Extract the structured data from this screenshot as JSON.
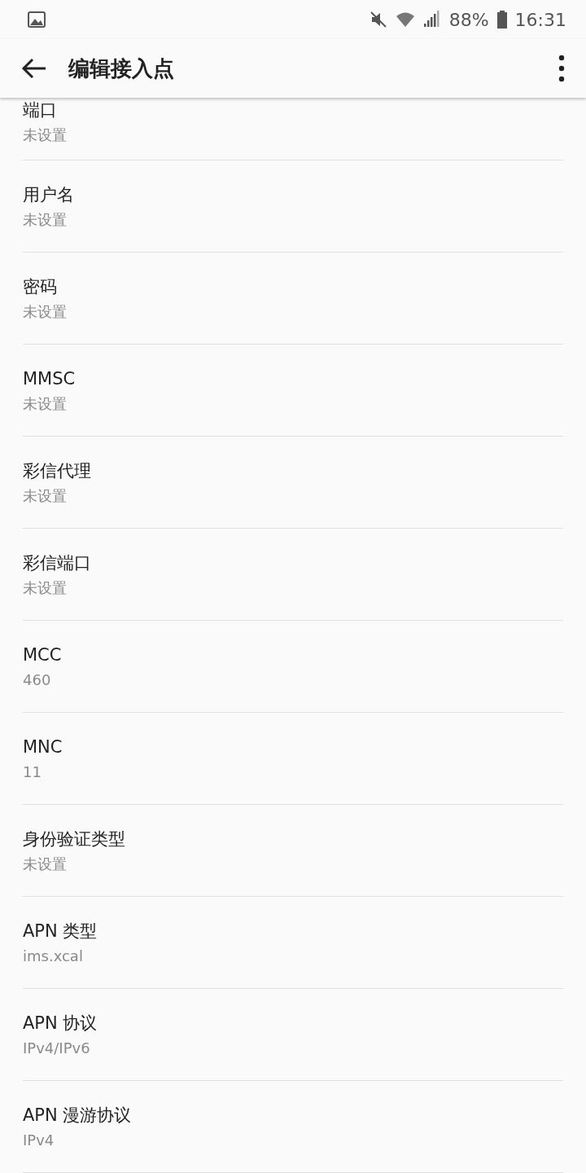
{
  "status_bar": {
    "battery": "88%",
    "time": "16:31"
  },
  "app_bar": {
    "title": "编辑接入点"
  },
  "settings": [
    {
      "title": "端口",
      "value": "未设置"
    },
    {
      "title": "用户名",
      "value": "未设置"
    },
    {
      "title": "密码",
      "value": "未设置"
    },
    {
      "title": "MMSC",
      "value": "未设置"
    },
    {
      "title": "彩信代理",
      "value": "未设置"
    },
    {
      "title": "彩信端口",
      "value": "未设置"
    },
    {
      "title": "MCC",
      "value": "460"
    },
    {
      "title": "MNC",
      "value": "11"
    },
    {
      "title": "身份验证类型",
      "value": "未设置"
    },
    {
      "title": "APN 类型",
      "value": "ims.xcal"
    },
    {
      "title": "APN 协议",
      "value": "IPv4/IPv6"
    },
    {
      "title": "APN 漫游协议",
      "value": "IPv4"
    }
  ]
}
